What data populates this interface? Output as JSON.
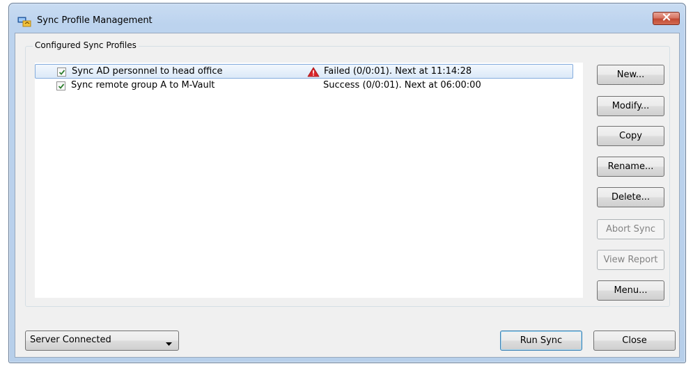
{
  "window": {
    "title": "Sync Profile Management",
    "icon": "sync-profile-app-icon",
    "close_icon": "close-x-icon"
  },
  "group": {
    "label": "Configured Sync Profiles"
  },
  "profiles": [
    {
      "checked": true,
      "name": "Sync AD personnel to head office",
      "status_icon": "warning-triangle-icon",
      "status": "Failed (0/0:01).  Next at 11:14:28",
      "selected": true
    },
    {
      "checked": true,
      "name": "Sync remote group A to M-Vault",
      "status_icon": "",
      "status": "Success (0/0:01).  Next at 06:00:00",
      "selected": false
    }
  ],
  "buttons": {
    "new": "New...",
    "modify": "Modify...",
    "copy": "Copy",
    "rename": "Rename...",
    "delete": "Delete...",
    "abort_sync": "Abort Sync",
    "view_report": "View Report",
    "menu": "Menu..."
  },
  "footer": {
    "server_select": "Server Connected",
    "run_sync": "Run Sync",
    "close": "Close"
  },
  "colors": {
    "selection_border": "#84acdd",
    "warning": "#d8252b",
    "close_button": "#c24a34"
  }
}
